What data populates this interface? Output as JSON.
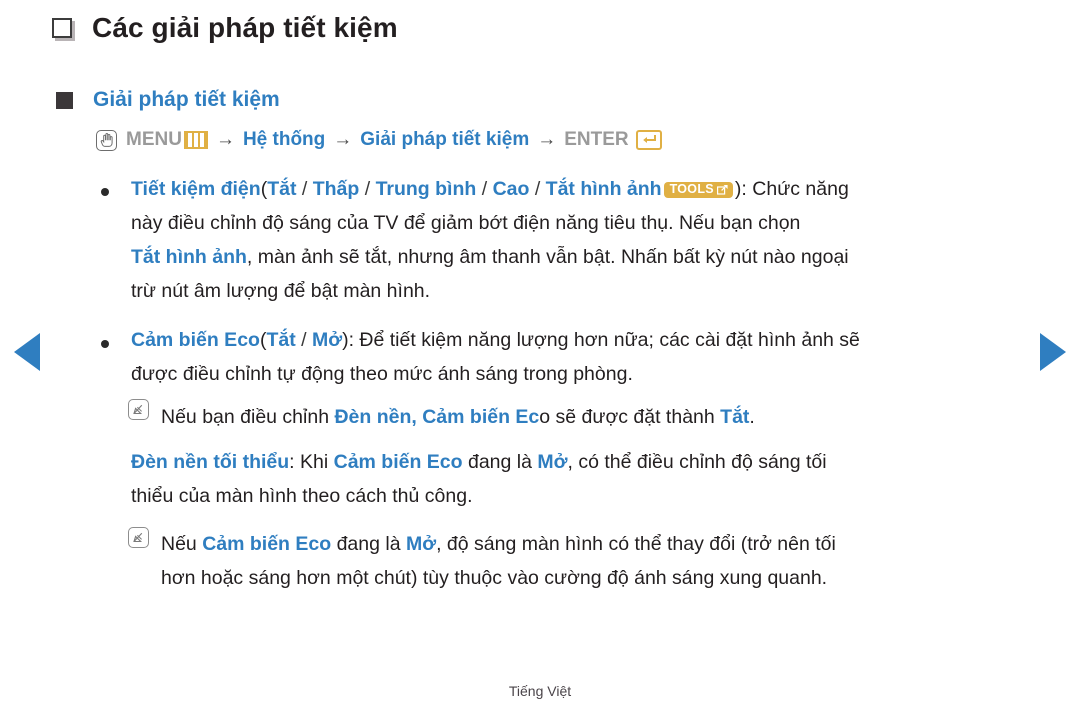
{
  "page": {
    "title": "Các giải pháp tiết kiệm",
    "footer": "Tiếng Việt",
    "accent_blue": "#2f7ec0",
    "accent_gold": "#e0b044",
    "text_color": "#231f20",
    "path_gray": "#9a9a9a"
  },
  "nav": {
    "prev_label": "◀",
    "next_label": "▶"
  },
  "section": {
    "heading": "Giải pháp tiết kiệm",
    "path": {
      "menu_label": "MENU",
      "step_system": "Hệ thống",
      "step_eco": "Giải pháp tiết kiệm",
      "enter_label": "ENTER",
      "arrow": "→",
      "hand_icon": "hand-pointer-icon",
      "menu_icon": "menu-bars-icon",
      "enter_icon": "enter-return-icon"
    }
  },
  "bullets": [
    {
      "term": "Tiết kiệm điện",
      "open_paren": "(",
      "options": [
        "Tắt",
        "Thấp",
        "Trung bình",
        "Cao",
        "Tắt hình ảnh"
      ],
      "option_separator": "/",
      "badge": "TOOLS",
      "close_paren": "):",
      "body_line1": "Chức năng",
      "body_line2": "này điều chỉnh độ sáng của TV để giảm bớt điện năng tiêu thụ. Nếu bạn chọn",
      "body_line3_bold": "Tắt hình ảnh",
      "body_line3_rest": ", màn ảnh sẽ tắt, nhưng âm thanh vẫn bật. Nhấn bất kỳ nút nào ngoại",
      "body_line4": "trừ nút âm lượng để bật màn hình."
    },
    {
      "term": "Cảm biến Eco",
      "open_paren": "(",
      "options": [
        "Tắt",
        "Mở"
      ],
      "option_separator": "/",
      "close_paren": "):",
      "body_line1": "Để tiết kiệm năng lượng hơn nữa; các cài đặt hình ảnh sẽ",
      "body_line2": "được điều chỉnh tự động theo mức ánh sáng trong phòng."
    }
  ],
  "notes": [
    {
      "icon": "note-pencil-icon",
      "prefix": "Nếu bạn điều chỉnh ",
      "bold1": "Đèn nền, Cảm biến Ec",
      "mid": "o sẽ được đặt thành ",
      "bold2": "Tắt",
      "suffix": "."
    }
  ],
  "subsection": {
    "term": "Đèn nền tối thiểu",
    "colon": ": Khi ",
    "bold1": "Cảm biến Eco",
    "mid1": " đang là ",
    "bold2": "Mở",
    "rest_line1": ", có thể điều chỉnh độ sáng tối",
    "line2": "thiểu của màn hình theo cách thủ công."
  },
  "note2": {
    "icon": "note-pencil-icon",
    "prefix": "Nếu ",
    "bold1": "Cảm biến Eco",
    "mid": " đang là ",
    "bold2": "Mở",
    "rest_line1": ", độ sáng màn hình có thể thay đổi (trở nên tối",
    "line2": "hơn hoặc sáng hơn một chút) tùy thuộc vào cường độ ánh sáng xung quanh."
  }
}
